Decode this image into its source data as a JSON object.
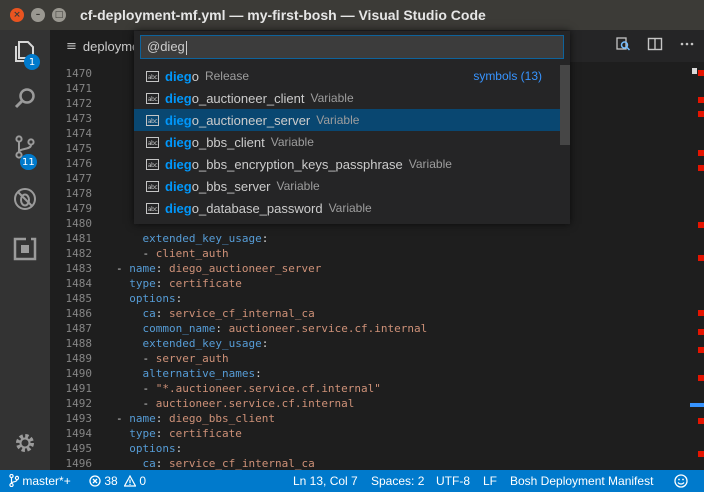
{
  "window": {
    "title": "cf-deployment-mf.yml — my-first-bosh — Visual Studio Code",
    "controls": {
      "close": "×",
      "minimize": "–",
      "maximize": "□"
    }
  },
  "activity_bar": {
    "items": [
      {
        "name": "explorer",
        "icon": "files-icon",
        "badge": "1"
      },
      {
        "name": "search",
        "icon": "search-icon",
        "badge": ""
      },
      {
        "name": "source-control",
        "icon": "git-branch-icon",
        "badge": "11"
      },
      {
        "name": "debug",
        "icon": "no-bug-icon",
        "badge": ""
      },
      {
        "name": "extensions",
        "icon": "extensions-icon",
        "badge": ""
      }
    ],
    "settings_icon": "gear-icon"
  },
  "tab": {
    "label": "deployme",
    "icon": "menu-lines-icon"
  },
  "tab_actions": [
    "open-changes-icon",
    "split-editor-icon",
    "more-icon"
  ],
  "quick_open": {
    "input_value": "@dieg",
    "match": "dieg",
    "group_label": "symbols (13)",
    "items": [
      {
        "pre": "",
        "hl": "dieg",
        "post": "o",
        "kind": "Release",
        "selected": false
      },
      {
        "pre": "",
        "hl": "dieg",
        "post": "o_auctioneer_client",
        "kind": "Variable",
        "selected": false
      },
      {
        "pre": "",
        "hl": "dieg",
        "post": "o_auctioneer_server",
        "kind": "Variable",
        "selected": true
      },
      {
        "pre": "",
        "hl": "dieg",
        "post": "o_bbs_client",
        "kind": "Variable",
        "selected": false
      },
      {
        "pre": "",
        "hl": "dieg",
        "post": "o_bbs_encryption_keys_passphrase",
        "kind": "Variable",
        "selected": false
      },
      {
        "pre": "",
        "hl": "dieg",
        "post": "o_bbs_server",
        "kind": "Variable",
        "selected": false
      },
      {
        "pre": "",
        "hl": "dieg",
        "post": "o_database_password",
        "kind": "Variable",
        "selected": false
      }
    ]
  },
  "editor": {
    "lines": [
      {
        "n": "1470",
        "i": 1,
        "k": "",
        "p": "",
        "v": ""
      },
      {
        "n": "1471",
        "i": 1,
        "k": "",
        "p": "",
        "v": ""
      },
      {
        "n": "1472",
        "i": 1,
        "k": "",
        "p": "",
        "v": ""
      },
      {
        "n": "1473",
        "i": 1,
        "k": "",
        "p": "",
        "v": ""
      },
      {
        "n": "1474",
        "i": 1,
        "k": "",
        "p": "",
        "v": ""
      },
      {
        "n": "1475",
        "i": 1,
        "k": "",
        "p": "",
        "v": ""
      },
      {
        "n": "1476",
        "i": 1,
        "k": "",
        "p": "",
        "v": ""
      },
      {
        "n": "1477",
        "i": 1,
        "k": "",
        "p": "",
        "v": ""
      },
      {
        "n": "1478",
        "i": 1,
        "k": "",
        "p": "",
        "v": ""
      },
      {
        "n": "1479",
        "i": 1,
        "k": "",
        "p": "",
        "v": ""
      },
      {
        "n": "1480",
        "i": 1,
        "k": "",
        "p": "",
        "v": ""
      },
      {
        "n": "1481",
        "i": 2,
        "k": "extended_key_usage",
        "p": ":",
        "v": ""
      },
      {
        "n": "1482",
        "i": 2,
        "k": "",
        "p": "- ",
        "v": "client_auth"
      },
      {
        "n": "1483",
        "i": 0,
        "k": "name",
        "p": "- ",
        "v": "diego_auctioneer_server"
      },
      {
        "n": "1484",
        "i": 1,
        "k": "type",
        "p": "",
        "v": "certificate"
      },
      {
        "n": "1485",
        "i": 1,
        "k": "options",
        "p": "",
        "v": ""
      },
      {
        "n": "1486",
        "i": 2,
        "k": "ca",
        "p": "",
        "v": "service_cf_internal_ca"
      },
      {
        "n": "1487",
        "i": 2,
        "k": "common_name",
        "p": "",
        "v": "auctioneer.service.cf.internal"
      },
      {
        "n": "1488",
        "i": 2,
        "k": "extended_key_usage",
        "p": "",
        "v": ""
      },
      {
        "n": "1489",
        "i": 2,
        "k": "",
        "p": "- ",
        "v": "server_auth"
      },
      {
        "n": "1490",
        "i": 2,
        "k": "alternative_names",
        "p": "",
        "v": ""
      },
      {
        "n": "1491",
        "i": 2,
        "k": "",
        "p": "- ",
        "v": "\"*.auctioneer.service.cf.internal\""
      },
      {
        "n": "1492",
        "i": 2,
        "k": "",
        "p": "- ",
        "v": "auctioneer.service.cf.internal"
      },
      {
        "n": "1493",
        "i": 0,
        "k": "name",
        "p": "- ",
        "v": "diego_bbs_client"
      },
      {
        "n": "1494",
        "i": 1,
        "k": "type",
        "p": "",
        "v": "certificate"
      },
      {
        "n": "1495",
        "i": 1,
        "k": "options",
        "p": "",
        "v": ""
      },
      {
        "n": "1496",
        "i": 2,
        "k": "ca",
        "p": "",
        "v": "service_cf_internal_ca"
      }
    ]
  },
  "status_bar": {
    "branch_icon": "git-branch-icon",
    "branch": "master*+",
    "errors_icon": "error-icon",
    "errors": "38",
    "warnings_icon": "warning-icon",
    "warnings": "0",
    "position": "Ln 13, Col 7",
    "spaces": "Spaces: 2",
    "encoding": "UTF-8",
    "eol": "LF",
    "language": "Bosh Deployment Manifest",
    "feedback_icon": "smiley-icon"
  },
  "colors": {
    "accent": "#007acc",
    "selection": "#094771",
    "match": "#0097fb",
    "key": "#569cd6",
    "string": "#ce9178"
  }
}
